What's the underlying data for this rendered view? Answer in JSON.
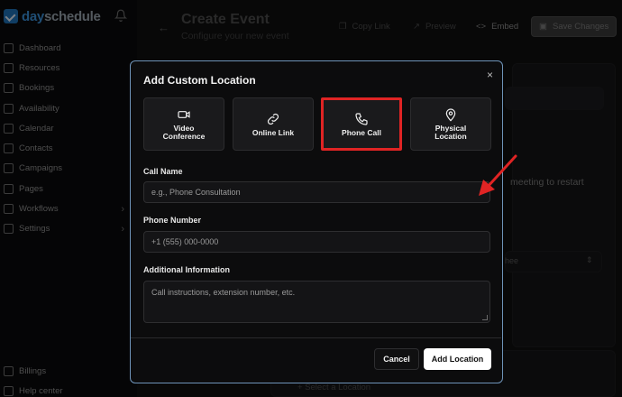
{
  "app": {
    "logo_day": "day",
    "logo_schedule": "schedule"
  },
  "sidebar": {
    "items": [
      {
        "label": "Dashboard"
      },
      {
        "label": "Resources"
      },
      {
        "label": "Bookings"
      },
      {
        "label": "Availability"
      },
      {
        "label": "Calendar"
      },
      {
        "label": "Contacts"
      },
      {
        "label": "Campaigns"
      },
      {
        "label": "Pages"
      },
      {
        "label": "Workflows",
        "has_children": true
      },
      {
        "label": "Settings",
        "has_children": true
      }
    ],
    "bottom": [
      {
        "label": "Billings"
      },
      {
        "label": "Help center"
      }
    ]
  },
  "header": {
    "title": "Create Event",
    "subtitle": "Configure your new event",
    "copy_link": "Copy Link",
    "preview": "Preview",
    "embed": "Embed",
    "save": "Save Changes"
  },
  "background": {
    "restart_text": "meeting to restart",
    "select_value": "hee",
    "select_location": "Select a Location"
  },
  "modal": {
    "title": "Add Custom Location",
    "close": "×",
    "options": [
      {
        "label": "Video\nConference",
        "icon": "video-icon",
        "selected": false
      },
      {
        "label": "Online Link",
        "icon": "link-icon",
        "selected": false
      },
      {
        "label": "Phone Call",
        "icon": "phone-icon",
        "selected": true
      },
      {
        "label": "Physical\nLocation",
        "icon": "map-pin-icon",
        "selected": false
      }
    ],
    "call_name_label": "Call Name",
    "call_name_placeholder": "e.g., Phone Consultation",
    "phone_label": "Phone Number",
    "phone_placeholder": "+1 (555) 000-0000",
    "info_label": "Additional Information",
    "info_placeholder": "Call instructions, extension number, etc.",
    "cancel": "Cancel",
    "add": "Add Location"
  },
  "colors": {
    "modal_border": "#6e93b8",
    "highlight": "#e02424",
    "primary_button": "#ffffff",
    "brand": "#1e6fb5"
  }
}
